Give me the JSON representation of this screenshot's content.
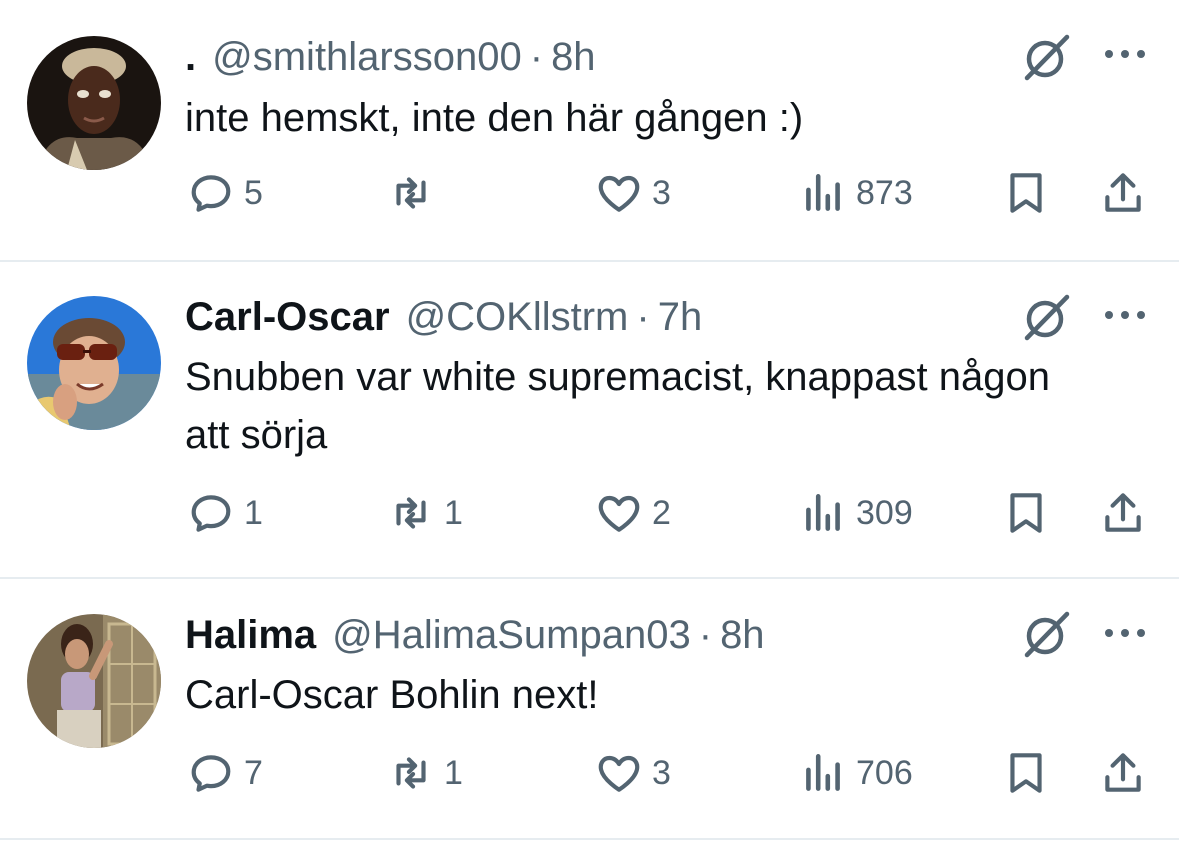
{
  "tweets": [
    {
      "name": ".",
      "handle": "@smithlarsson00",
      "separator": "·",
      "time": "8h",
      "text": "inte hemskt, inte den här gången :)",
      "replies": "5",
      "retweets": "",
      "likes": "3",
      "views": "873"
    },
    {
      "name": "Carl-Oscar",
      "handle": "@COKllstrm",
      "separator": "·",
      "time": "7h",
      "text": "Snubben var white supremacist, knappast någon att sörja",
      "replies": "1",
      "retweets": "1",
      "likes": "2",
      "views": "309"
    },
    {
      "name": "Halima",
      "handle": "@HalimaSumpan03",
      "separator": "·",
      "time": "8h",
      "text": "Carl-Oscar Bohlin next!",
      "replies": "7",
      "retweets": "1",
      "likes": "3",
      "views": "706"
    }
  ],
  "icons": {
    "reply": "reply-icon",
    "retweet": "retweet-icon",
    "like": "like-icon",
    "views": "views-icon",
    "bookmark": "bookmark-icon",
    "share": "share-icon",
    "grok": "grok-icon",
    "more": "more-icon"
  },
  "colors": {
    "text": "#0f1419",
    "secondary": "#536471",
    "divider": "#e6ecf0"
  }
}
